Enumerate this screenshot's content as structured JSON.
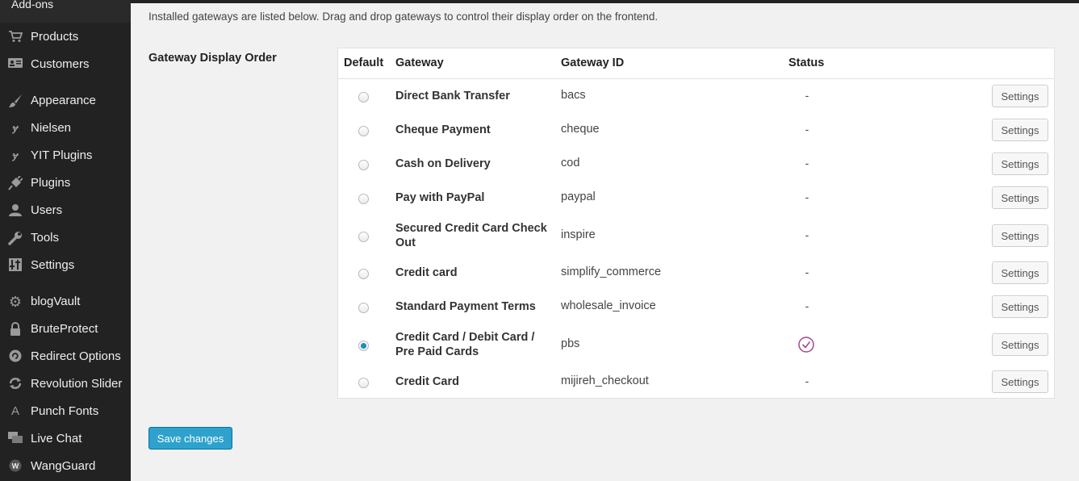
{
  "sidebar": {
    "top_item": "Add-ons",
    "items": [
      {
        "label": "Products",
        "icon": "cart-icon"
      },
      {
        "label": "Customers",
        "icon": "id-card-icon"
      },
      {
        "label": "Appearance",
        "icon": "paintbrush-icon"
      },
      {
        "label": "Nielsen",
        "icon": "yit-icon"
      },
      {
        "label": "YIT Plugins",
        "icon": "yit-icon"
      },
      {
        "label": "Plugins",
        "icon": "plugin-icon"
      },
      {
        "label": "Users",
        "icon": "user-icon"
      },
      {
        "label": "Tools",
        "icon": "wrench-icon"
      },
      {
        "label": "Settings",
        "icon": "settings-sliders-icon"
      },
      {
        "label": "blogVault",
        "icon": "gear-icon"
      },
      {
        "label": "BruteProtect",
        "icon": "lock-icon"
      },
      {
        "label": "Redirect Options",
        "icon": "redirect-icon"
      },
      {
        "label": "Revolution Slider",
        "icon": "refresh-icon"
      },
      {
        "label": "Punch Fonts",
        "icon": "font-icon"
      },
      {
        "label": "Live Chat",
        "icon": "chat-icon"
      },
      {
        "label": "WangGuard",
        "icon": "wangguard-icon"
      }
    ]
  },
  "main": {
    "intro": "Installed gateways are listed below. Drag and drop gateways to control their display order on the frontend.",
    "row_label": "Gateway Display Order",
    "table": {
      "headers": {
        "default": "Default",
        "gateway": "Gateway",
        "gateway_id": "Gateway ID",
        "status": "Status"
      },
      "rows": [
        {
          "name": "Direct Bank Transfer",
          "id": "bacs",
          "status": "-",
          "default": false
        },
        {
          "name": "Cheque Payment",
          "id": "cheque",
          "status": "-",
          "default": false
        },
        {
          "name": "Cash on Delivery",
          "id": "cod",
          "status": "-",
          "default": false
        },
        {
          "name": "Pay with PayPal",
          "id": "paypal",
          "status": "-",
          "default": false
        },
        {
          "name": "Secured Credit Card Check Out",
          "id": "inspire",
          "status": "-",
          "default": false
        },
        {
          "name": "Credit card",
          "id": "simplify_commerce",
          "status": "-",
          "default": false
        },
        {
          "name": "Standard Payment Terms",
          "id": "wholesale_invoice",
          "status": "-",
          "default": false
        },
        {
          "name": "Credit Card / Debit Card / Pre Paid Cards",
          "id": "pbs",
          "status": "enabled",
          "default": true
        },
        {
          "name": "Credit Card",
          "id": "mijireh_checkout",
          "status": "-",
          "default": false
        }
      ],
      "settings_label": "Settings"
    },
    "save_label": "Save changes"
  },
  "colors": {
    "sidebar_bg": "#222222",
    "accent": "#2ea2cc",
    "check": "#a3488a"
  }
}
